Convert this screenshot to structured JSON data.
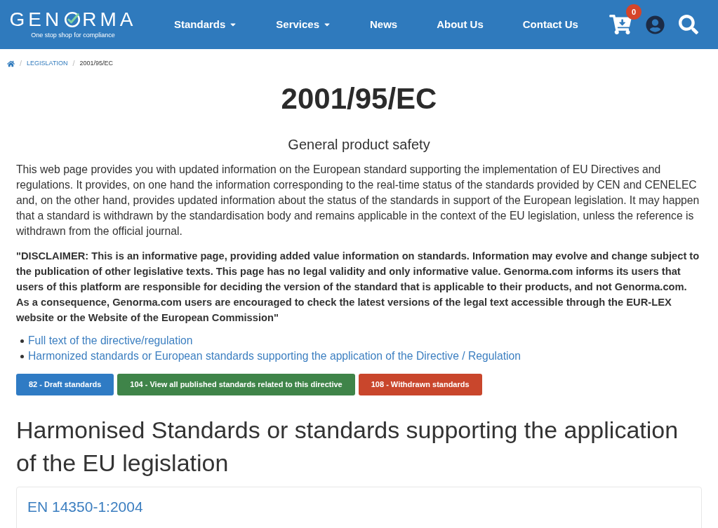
{
  "header": {
    "logo": {
      "name_start": "GEN",
      "name_end": "RMA",
      "tagline": "One stop shop for compliance"
    },
    "nav": [
      {
        "label": "Standards",
        "has_menu": true
      },
      {
        "label": "Services",
        "has_menu": true
      },
      {
        "label": "News",
        "has_menu": false
      },
      {
        "label": "About Us",
        "has_menu": false
      },
      {
        "label": "Contact Us",
        "has_menu": false
      }
    ],
    "cart": {
      "count": "0"
    }
  },
  "breadcrumb": [
    {
      "kind": "home"
    },
    {
      "kind": "link",
      "label": "LEGISLATION",
      "separator": "/"
    },
    {
      "kind": "current",
      "label": "2001/95/EC",
      "separator": "/"
    }
  ],
  "title": "2001/95/EC",
  "subtitle": "General product safety",
  "intro": "This web page provides you with updated information on the European standard supporting the implementation of EU Directives and regulations. It provides, on one hand the information corresponding to the real-time status of the standards provided by CEN and CENELEC and, on the other hand, provides updated information about the status of the standards in support of the European legislation. It may happen that a standard is withdrawn by the standardisation body and remains applicable in the context of the EU legislation, unless the reference is withdrawn from the official journal.",
  "disclaimer": "\"DISCLAIMER: This is an informative page, providing added value information on standards. Information may evolve and change subject to the publication of other legislative texts. This page has no legal validity and only informative value. Genorma.com informs its users that users of this platform are responsible for deciding the version of the standard that is applicable to their products, and not Genorma.com. As a consequence, Genorma.com users are encouraged to check the latest versions of the legal text accessible through the EUR-LEX website or the Website of the European Commission\"",
  "links": [
    "Full text of the directive/regulation",
    "Harmonized standards or European standards supporting the application of the Directive / Regulation"
  ],
  "buttons": [
    {
      "label": "82 - Draft standards",
      "color": "#2f7bc4"
    },
    {
      "label": "104 - View all published standards related to this directive",
      "color": "#3f8449"
    },
    {
      "label": "108 - Withdrawn standards",
      "color": "#c9462c"
    }
  ],
  "section": {
    "heading": "Harmonised Standards or standards supporting the application of the EU legislation",
    "cards": [
      {
        "title": "EN 14350-1:2004"
      }
    ]
  }
}
